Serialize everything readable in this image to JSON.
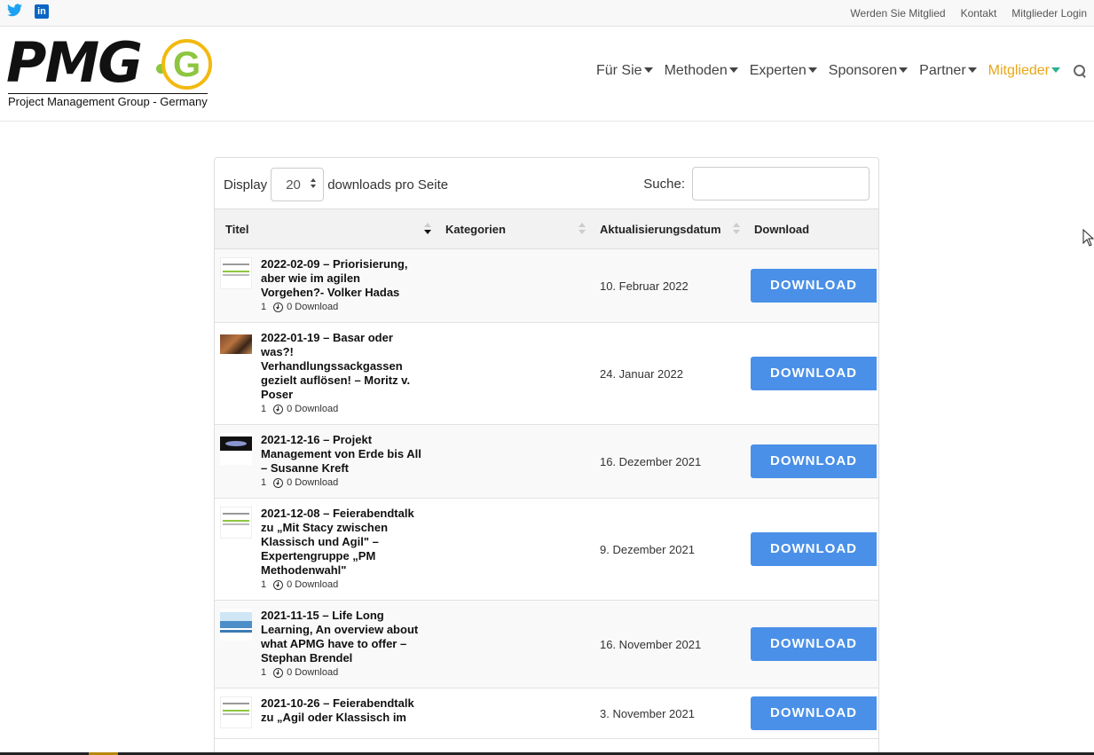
{
  "topbar": {
    "social": [
      "twitter-icon",
      "linkedin-icon"
    ],
    "links": [
      "Werden Sie Mitglied",
      "Kontakt",
      "Mitglieder Login"
    ]
  },
  "logo": {
    "letters": "PMG",
    "g_letter": "G",
    "tagline": "Project Management Group - Germany"
  },
  "nav": {
    "items": [
      {
        "label": "Für Sie",
        "active": false
      },
      {
        "label": "Methoden",
        "active": false
      },
      {
        "label": "Experten",
        "active": false
      },
      {
        "label": "Sponsoren",
        "active": false
      },
      {
        "label": "Partner",
        "active": false
      },
      {
        "label": "Mitglieder",
        "active": true
      }
    ],
    "active_color": "#e8a617"
  },
  "controls": {
    "display_label": "Display",
    "per_page_value": "20",
    "per_page_suffix": "downloads pro Seite",
    "search_label": "Suche:",
    "search_value": ""
  },
  "table": {
    "headers": [
      "Titel",
      "Kategorien",
      "Aktualisierungsdatum",
      "Download"
    ],
    "sort_column": "Titel",
    "sort_direction": "desc",
    "rows": [
      {
        "thumb": "t-slide",
        "title": "2022-02-09 – Priorisierung, aber wie im agilen Vorgehen?- Volker Hadas",
        "count": "1",
        "downloads": "0 Download",
        "category": "",
        "date": "10. Februar 2022",
        "button": "DOWNLOAD"
      },
      {
        "thumb": "t-photo",
        "title": "2022-01-19 – Basar oder was?! Verhandlungssackgassen gezielt auflösen! – Moritz v. Poser",
        "count": "1",
        "downloads": "0 Download",
        "category": "",
        "date": "24. Januar 2022",
        "button": "DOWNLOAD"
      },
      {
        "thumb": "t-space",
        "title": "2021-12-16 – Projekt Management von Erde bis All – Susanne Kreft",
        "count": "1",
        "downloads": "0 Download",
        "category": "",
        "date": "16. Dezember 2021",
        "button": "DOWNLOAD"
      },
      {
        "thumb": "t-slide",
        "title": "2021-12-08 – Feierabendtalk zu „Mit Stacy zwischen Klassisch und Agil\" – Expertengruppe „PM Methodenwahl\"",
        "count": "1",
        "downloads": "0 Download",
        "category": "",
        "date": "9. Dezember 2021",
        "button": "DOWNLOAD"
      },
      {
        "thumb": "t-blue",
        "title": "2021-11-15 – Life Long Learning, An overview about what APMG have to offer – Stephan Brendel",
        "count": "1",
        "downloads": "0 Download",
        "category": "",
        "date": "16. November 2021",
        "button": "DOWNLOAD"
      },
      {
        "thumb": "t-slide",
        "title": "2021-10-26 – Feierabendtalk zu „Agil oder Klassisch im",
        "count": "",
        "downloads": "",
        "category": "",
        "date": "3. November 2021",
        "button": "DOWNLOAD"
      }
    ],
    "button_color": "#4a90e8"
  }
}
